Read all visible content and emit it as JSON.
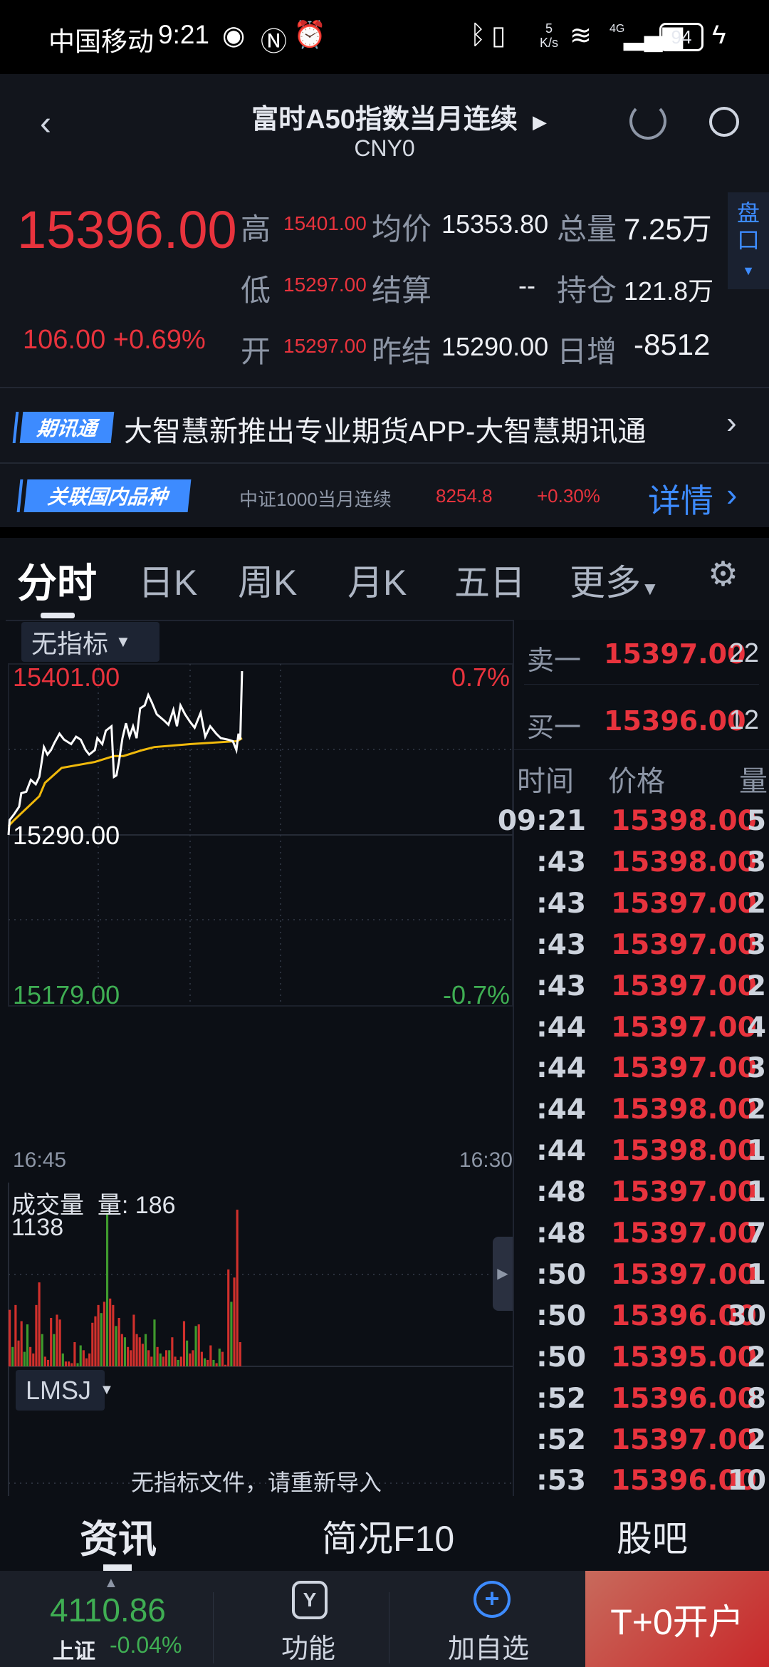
{
  "status": {
    "carrier": "中国移动",
    "time": "9:21",
    "net_speed_top": "5",
    "net_speed_bottom": "K/s",
    "network": "4G",
    "battery": "94"
  },
  "header": {
    "title": "富时A50指数当月连续",
    "code": "CNY0"
  },
  "quote": {
    "price": "15396.00",
    "change": "106.00",
    "change_pct": "+0.69%",
    "high_label": "高",
    "high": "15401.00",
    "low_label": "低",
    "low": "15297.00",
    "open_label": "开",
    "open": "15297.00",
    "avg_label": "均价",
    "avg": "15353.80",
    "settle_label": "结算",
    "settle": "--",
    "prev_settle_label": "昨结",
    "prev_settle": "15290.00",
    "volume_label": "总量",
    "volume": "7.25万",
    "oi_label": "持仓",
    "oi": "121.8万",
    "daily_inc_label": "日增",
    "daily_inc": "-8512",
    "panel_toggle": "盘口"
  },
  "news": {
    "badge": "期讯通",
    "text": "大智慧新推出专业期货APP-大智慧期讯通"
  },
  "related": {
    "badge": "关联国内品种",
    "name": "中证1000当月连续",
    "price": "8254.8",
    "pct": "+0.30%",
    "detail": "详情"
  },
  "tabs": [
    "分时",
    "日K",
    "周K",
    "月K",
    "五日",
    "更多"
  ],
  "indicator": {
    "main": "无指标",
    "sub": "LMSJ",
    "sub_msg": "无指标文件，请重新导入"
  },
  "order_book": {
    "ask_label": "卖一",
    "ask_price": "15397.00",
    "ask_qty": "22",
    "bid_label": "买一",
    "bid_price": "15396.00",
    "bid_qty": "12"
  },
  "ticks_header": {
    "time": "时间",
    "price": "价格",
    "qty": "量"
  },
  "ticks": [
    {
      "time": "09:21",
      "price": "15398.00",
      "qty": "5"
    },
    {
      "time": ":43",
      "price": "15398.00",
      "qty": "3"
    },
    {
      "time": ":43",
      "price": "15397.00",
      "qty": "2"
    },
    {
      "time": ":43",
      "price": "15397.00",
      "qty": "3"
    },
    {
      "time": ":43",
      "price": "15397.00",
      "qty": "2"
    },
    {
      "time": ":44",
      "price": "15397.00",
      "qty": "4"
    },
    {
      "time": ":44",
      "price": "15397.00",
      "qty": "3"
    },
    {
      "time": ":44",
      "price": "15398.00",
      "qty": "2"
    },
    {
      "time": ":44",
      "price": "15398.00",
      "qty": "1"
    },
    {
      "time": ":48",
      "price": "15397.00",
      "qty": "1"
    },
    {
      "time": ":48",
      "price": "15397.00",
      "qty": "7"
    },
    {
      "time": ":50",
      "price": "15397.00",
      "qty": "1"
    },
    {
      "time": ":50",
      "price": "15396.00",
      "qty": "30"
    },
    {
      "time": ":50",
      "price": "15395.00",
      "qty": "2"
    },
    {
      "time": ":52",
      "price": "15396.00",
      "qty": "8"
    },
    {
      "time": ":52",
      "price": "15397.00",
      "qty": "2"
    },
    {
      "time": ":53",
      "price": "15396.00",
      "qty": "10"
    }
  ],
  "bottom_tabs": [
    "资讯",
    "简况F10",
    "股吧"
  ],
  "bottom_bar": {
    "index_value": "4110.86",
    "index_name": "上证",
    "index_pct": "-0.04%",
    "func": "功能",
    "add": "加自选",
    "open_account": "T+0开户"
  },
  "chart_data": {
    "type": "line",
    "y_labels": {
      "top": "15401.00",
      "mid": "15290.00",
      "bottom": "15179.00",
      "top_pct": "0.7%",
      "bottom_pct": "-0.7%"
    },
    "ylim": [
      15179,
      15401
    ],
    "base": 15290,
    "x_labels": {
      "start": "16:45",
      "end": "16:30"
    },
    "xlim": [
      0,
      1425
    ],
    "x_unit": "minutes",
    "price": [
      [
        0,
        15290
      ],
      [
        3,
        15300
      ],
      [
        16,
        15304
      ],
      [
        30,
        15309
      ],
      [
        36,
        15318
      ],
      [
        50,
        15319
      ],
      [
        63,
        15327
      ],
      [
        77,
        15324
      ],
      [
        87,
        15329
      ],
      [
        93,
        15338
      ],
      [
        100,
        15349
      ],
      [
        110,
        15344
      ],
      [
        120,
        15347
      ],
      [
        130,
        15352
      ],
      [
        144,
        15358
      ],
      [
        157,
        15354
      ],
      [
        177,
        15351
      ],
      [
        191,
        15356
      ],
      [
        204,
        15354
      ],
      [
        218,
        15347
      ],
      [
        228,
        15344
      ],
      [
        244,
        15347
      ],
      [
        251,
        15355
      ],
      [
        265,
        15351
      ],
      [
        275,
        15360
      ],
      [
        291,
        15363
      ],
      [
        298,
        15329
      ],
      [
        305,
        15330
      ],
      [
        312,
        15339
      ],
      [
        322,
        15355
      ],
      [
        332,
        15365
      ],
      [
        342,
        15356
      ],
      [
        352,
        15363
      ],
      [
        362,
        15355
      ],
      [
        372,
        15375
      ],
      [
        385,
        15377
      ],
      [
        395,
        15384
      ],
      [
        405,
        15379
      ],
      [
        419,
        15371
      ],
      [
        439,
        15367
      ],
      [
        452,
        15364
      ],
      [
        466,
        15374
      ],
      [
        476,
        15363
      ],
      [
        486,
        15377
      ],
      [
        499,
        15371
      ],
      [
        513,
        15366
      ],
      [
        526,
        15362
      ],
      [
        543,
        15372
      ],
      [
        556,
        15356
      ],
      [
        570,
        15363
      ],
      [
        587,
        15358
      ],
      [
        600,
        15355
      ],
      [
        620,
        15354
      ],
      [
        634,
        15353
      ],
      [
        644,
        15347
      ],
      [
        650,
        15358
      ],
      [
        655,
        15354
      ],
      [
        660,
        15400
      ]
    ],
    "avg": [
      [
        0,
        15296
      ],
      [
        16,
        15300
      ],
      [
        56,
        15309
      ],
      [
        87,
        15316
      ],
      [
        103,
        15325
      ],
      [
        150,
        15335
      ],
      [
        244,
        15339
      ],
      [
        298,
        15343
      ],
      [
        325,
        15343
      ],
      [
        379,
        15347
      ],
      [
        412,
        15349
      ],
      [
        513,
        15351
      ],
      [
        647,
        15353
      ],
      [
        660,
        15355
      ]
    ],
    "volume_title": "成交量",
    "volume_label": "量: 186",
    "volume_max": "1138",
    "volume_ylim": [
      0,
      1138
    ],
    "volume": [
      [
        350,
        "r"
      ],
      [
        120,
        "g"
      ],
      [
        380,
        "r"
      ],
      [
        160,
        "r"
      ],
      [
        280,
        "r"
      ],
      [
        90,
        "g"
      ],
      [
        260,
        "g"
      ],
      [
        120,
        "r"
      ],
      [
        80,
        "r"
      ],
      [
        380,
        "r"
      ],
      [
        520,
        "r"
      ],
      [
        200,
        "g"
      ],
      [
        60,
        "r"
      ],
      [
        40,
        "r"
      ],
      [
        300,
        "r"
      ],
      [
        200,
        "g"
      ],
      [
        320,
        "r"
      ],
      [
        290,
        "r"
      ],
      [
        80,
        "g"
      ],
      [
        30,
        "r"
      ],
      [
        30,
        "r"
      ],
      [
        20,
        "r"
      ],
      [
        150,
        "r"
      ],
      [
        20,
        "g"
      ],
      [
        130,
        "g"
      ],
      [
        100,
        "r"
      ],
      [
        50,
        "r"
      ],
      [
        80,
        "r"
      ],
      [
        270,
        "r"
      ],
      [
        310,
        "r"
      ],
      [
        380,
        "r"
      ],
      [
        330,
        "g"
      ],
      [
        400,
        "r"
      ],
      [
        950,
        "g"
      ],
      [
        420,
        "r"
      ],
      [
        380,
        "r"
      ],
      [
        250,
        "g"
      ],
      [
        300,
        "r"
      ],
      [
        200,
        "r"
      ],
      [
        180,
        "g"
      ],
      [
        120,
        "r"
      ],
      [
        100,
        "r"
      ],
      [
        320,
        "r"
      ],
      [
        200,
        "r"
      ],
      [
        180,
        "r"
      ],
      [
        140,
        "r"
      ],
      [
        200,
        "g"
      ],
      [
        100,
        "r"
      ],
      [
        60,
        "r"
      ],
      [
        290,
        "g"
      ],
      [
        120,
        "r"
      ],
      [
        80,
        "g"
      ],
      [
        60,
        "r"
      ],
      [
        100,
        "r"
      ],
      [
        100,
        "g"
      ],
      [
        180,
        "r"
      ],
      [
        60,
        "r"
      ],
      [
        40,
        "g"
      ],
      [
        60,
        "r"
      ],
      [
        280,
        "r"
      ],
      [
        160,
        "g"
      ],
      [
        80,
        "r"
      ],
      [
        100,
        "r"
      ],
      [
        250,
        "g"
      ],
      [
        260,
        "r"
      ],
      [
        90,
        "r"
      ],
      [
        50,
        "g"
      ],
      [
        40,
        "r"
      ],
      [
        130,
        "r"
      ],
      [
        40,
        "g"
      ],
      [
        20,
        "r"
      ],
      [
        110,
        "g"
      ],
      [
        90,
        "r"
      ],
      [
        10,
        "r"
      ],
      [
        600,
        "r"
      ],
      [
        400,
        "g"
      ],
      [
        550,
        "r"
      ],
      [
        970,
        "r"
      ],
      [
        150,
        "r"
      ]
    ],
    "colors": {
      "price": "#ffffff",
      "avg": "#f0b90b",
      "up": "#d1302c",
      "down": "#3f9a2e"
    }
  }
}
